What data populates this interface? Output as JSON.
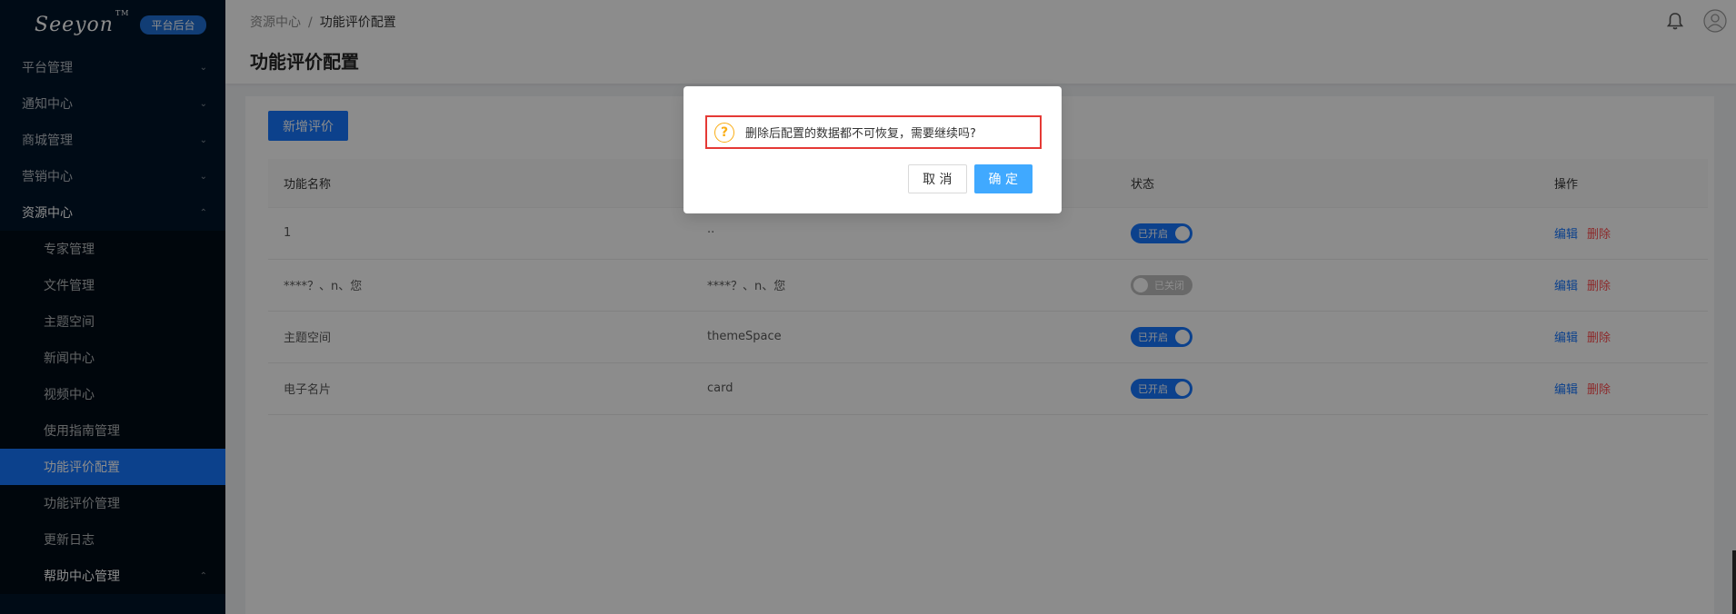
{
  "sidebar": {
    "logo": "Seeyon",
    "logo_tm": "TM",
    "badge": "平台后台",
    "menu": [
      {
        "label": "平台管理",
        "chevron": "⌄"
      },
      {
        "label": "通知中心",
        "chevron": "⌄"
      },
      {
        "label": "商城管理",
        "chevron": "⌄"
      },
      {
        "label": "营销中心",
        "chevron": "⌄"
      },
      {
        "label": "资源中心",
        "chevron": "⌃"
      }
    ],
    "submenu": [
      {
        "label": "专家管理"
      },
      {
        "label": "文件管理"
      },
      {
        "label": "主题空间"
      },
      {
        "label": "新闻中心"
      },
      {
        "label": "视频中心"
      },
      {
        "label": "使用指南管理"
      },
      {
        "label": "功能评价配置"
      },
      {
        "label": "功能评价管理"
      },
      {
        "label": "更新日志"
      },
      {
        "label": "帮助中心管理",
        "chevron": "⌃"
      }
    ]
  },
  "header": {
    "breadcrumb_root": "资源中心",
    "breadcrumb_sep": "/",
    "breadcrumb_current": "功能评价配置",
    "page_title": "功能评价配置"
  },
  "toolbar": {
    "add_label": "新增评价"
  },
  "table": {
    "columns": [
      "功能名称",
      "",
      "状态",
      "操作"
    ],
    "rows": [
      {
        "name": "1",
        "code": "··",
        "status": "已开启",
        "on": true
      },
      {
        "name": "****？、n、您",
        "code": "****？、n、您",
        "status": "已关闭",
        "on": false
      },
      {
        "name": "主题空间",
        "code": "themeSpace",
        "status": "已开启",
        "on": true
      },
      {
        "name": "电子名片",
        "code": "card",
        "status": "已开启",
        "on": true
      }
    ],
    "edit_label": "编辑",
    "delete_label": "删除"
  },
  "modal": {
    "message": "删除后配置的数据都不可恢复，需要继续吗?",
    "cancel_label": "取 消",
    "ok_label": "确 定"
  },
  "colors": {
    "sidebar_bg": "#001529",
    "accent": "#1677ff",
    "danger": "#ff4d4f",
    "warning": "#faad14"
  }
}
